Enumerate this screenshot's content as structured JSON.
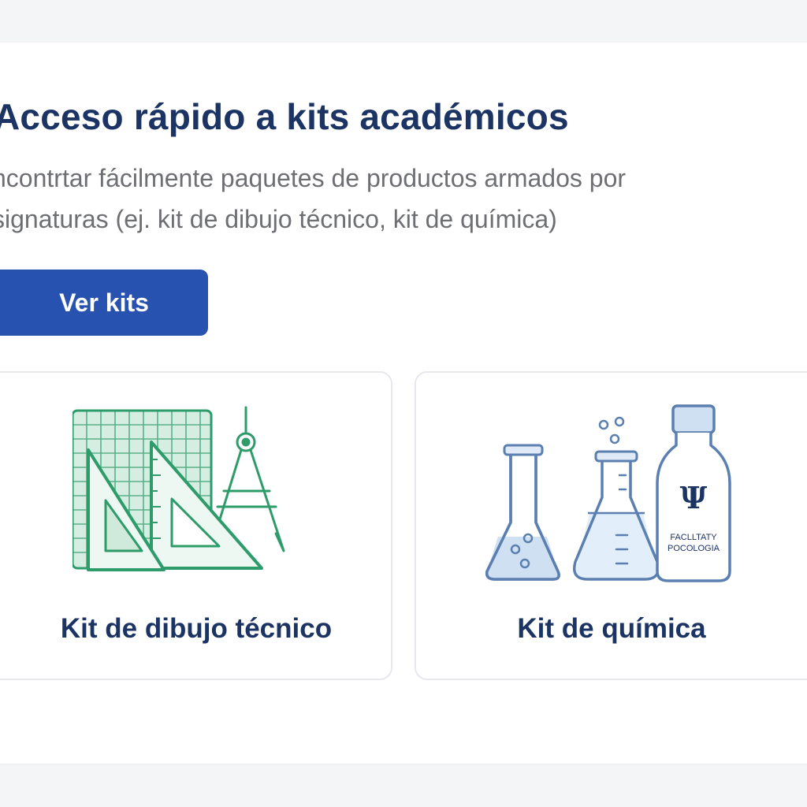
{
  "section": {
    "title": "Acceso rápido a kits académicos",
    "description": "ncontrtar fácilmente paquetes de productos armados por signaturas (ej. kit de dibujo técnico, kit de química)",
    "cta_label": "Ver kits"
  },
  "kits": [
    {
      "label": "Kit de dibujo técnico",
      "icon": "technical-drawing-icon"
    },
    {
      "label": "Kit de química",
      "icon": "chemistry-icon",
      "bottle_symbol": "Ψ",
      "bottle_text_line1": "FACLLTATY",
      "bottle_text_line2": "POCOLOGIA"
    }
  ],
  "colors": {
    "title": "#1c3464",
    "text": "#6d6f73",
    "accent": "#2752b0",
    "drawing_green": "#2e9c6a",
    "glass_blue": "#5a7fb0",
    "liquid_blue": "#cfe0f3"
  }
}
